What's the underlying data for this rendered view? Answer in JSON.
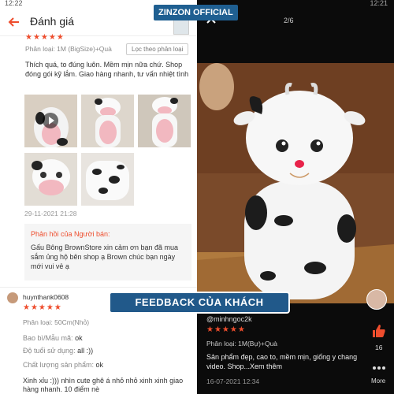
{
  "brand": "ZINZON OFFICIAL",
  "banner": "FEEDBACK CỦA KHÁCH",
  "left": {
    "status_time": "12:22",
    "header_title": "Đánh giá",
    "review1": {
      "stars": "★★★★★",
      "variant": "Phân loại: 1M (BigSize)+Quà",
      "similar_button": "Lọc theo phân loại",
      "text": "Thích quá, to đúng luôn. Mềm mịn nữa chứ. Shop đóng gói kỹ lắm. Giao hàng nhanh, tư vấn nhiệt tình",
      "date": "29-11-2021 21:28"
    },
    "reply": {
      "title": "Phản hồi của Người bán:",
      "body": "Gấu Bông BrownStore xin cảm ơn bạn đã mua sắm ủng hộ bên shop ạ Brown chúc bạn ngày mới vui vẻ ạ"
    },
    "review2": {
      "user": "huynthank0608",
      "stars": "★★★★★",
      "variant": "Phân loại: 50Cm(Nhỏ)",
      "fields": [
        {
          "label": "Bao bì/Mẫu mã:",
          "value": "ok"
        },
        {
          "label": "Độ tuổi sử dụng:",
          "value": "all :))"
        },
        {
          "label": "Chất lượng sản phẩm:",
          "value": "ok"
        }
      ],
      "text": "Xinh xỉu :))) nhìn cute ghê á nhỏ nhỏ xinh xinh giao hàng nhanh. 10 điểm nè"
    }
  },
  "right": {
    "status_time": "12:21",
    "counter": "2/6",
    "user": "@minhngoc2k",
    "stars": "★★★★★",
    "variant": "Phân loại: 1M(Bự)+Quà",
    "text": "Sản phẩm đẹp, cao to, mềm mịn, giống y chang video. Shop...Xem thêm",
    "date": "16-07-2021 12:34",
    "like_count": "16",
    "more_label": "More"
  },
  "colors": {
    "accent": "#ee4d2d",
    "brand_bg": "#1f5f91",
    "viewer_bg": "#0b0b0b"
  }
}
